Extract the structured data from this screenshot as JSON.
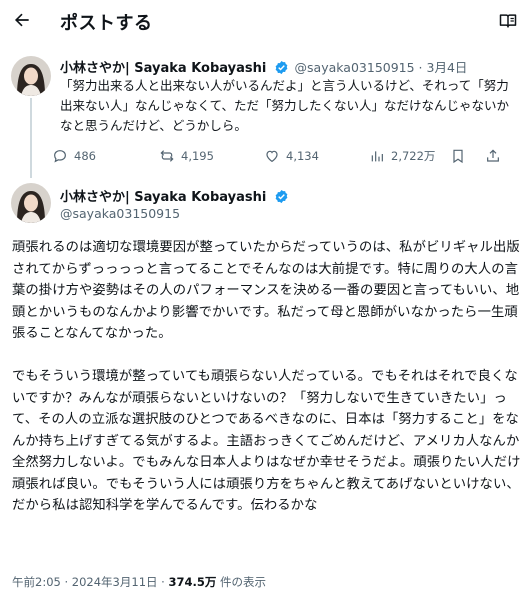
{
  "header": {
    "title": "ポストする"
  },
  "icons": {
    "back": "arrow-left-icon",
    "reader": "reader-mode-icon",
    "verified": "verified-badge-icon"
  },
  "colors": {
    "verified": "#1d9bf0",
    "muted": "#536471",
    "text": "#0f1419"
  },
  "quoted_post": {
    "author_name": "小林さやか| Sayaka Kobayashi",
    "handle_date": "@sayaka03150915 · 3月4日",
    "text": "「努力出来る人と出来ない人がいるんだよ」と言う人いるけど、それって「努力出来ない人」なんじゃなくて、ただ「努力したくない人」なだけなんじゃないかなと思うんだけど、どうかしら。",
    "replies": "486",
    "reposts": "4,195",
    "likes": "4,134",
    "views": "2,722万"
  },
  "main_post": {
    "author_name": "小林さやか| Sayaka Kobayashi",
    "handle": "@sayaka03150915",
    "text": "頑張れるのは適切な環境要因が整っていたからだっていうのは、私がビリギャル出版されてからずっっっっと言ってることでそんなのは大前提です。特に周りの大人の言葉の掛け方や姿勢はその人のパフォーマンスを決める一番の要因と言ってもいい、地頭とかいうものなんかより影響でかいです。私だって母と恩師がいなかったら一生頑張ることなんてなかった。\n\nでもそういう環境が整っていても頑張らない人だっている。でもそれはそれで良くないですか？みんなが頑張らないといけないの？「努力しないで生きていきたい」って、その人の立派な選択肢のひとつであるべきなのに、日本は「努力すること」をなんか持ち上げすぎてる気がするよ。主語おっきくてごめんだけど、アメリカ人なんか全然努力しないよ。でもみんな日本人よりはなぜか幸せそうだよ。頑張りたい人だけ頑張れば良い。でもそういう人には頑張り方をちゃんと教えてあげないといけない、だから私は認知科学を学んでるんです。伝わるかな",
    "timestamp": "午前2:05 · 2024年3月11日 · ",
    "views_count": "374.5万",
    "views_suffix": " 件の表示"
  }
}
